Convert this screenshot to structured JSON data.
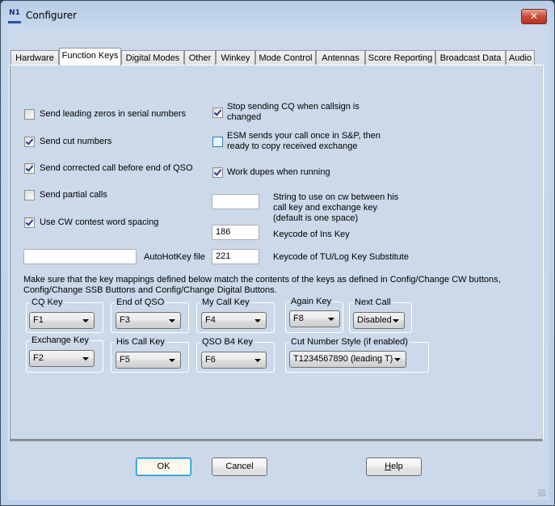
{
  "window": {
    "title": "Configurer",
    "app_icon": "N1MM-logo-icon",
    "close_label": "x"
  },
  "tabs": [
    {
      "label": "Hardware",
      "active": false
    },
    {
      "label": "Function Keys",
      "active": true
    },
    {
      "label": "Digital Modes",
      "active": false
    },
    {
      "label": "Other",
      "active": false
    },
    {
      "label": "Winkey",
      "active": false
    },
    {
      "label": "Mode Control",
      "active": false
    },
    {
      "label": "Antennas",
      "active": false
    },
    {
      "label": "Score Reporting",
      "active": false
    },
    {
      "label": "Broadcast Data",
      "active": false
    },
    {
      "label": "Audio",
      "active": false
    }
  ],
  "left_checkboxes": [
    {
      "label": "Send leading zeros in serial numbers",
      "checked": false
    },
    {
      "label": "Send cut numbers",
      "checked": true
    },
    {
      "label": "Send corrected call before end of QSO",
      "checked": true
    },
    {
      "label": "Send partial calls",
      "checked": false
    },
    {
      "label": "Use CW contest word spacing",
      "checked": true
    }
  ],
  "right_checkboxes": [
    {
      "label_line1": "Stop sending CQ when callsign is",
      "label_line2": "changed",
      "checked": true
    },
    {
      "label_line1": "ESM sends your call once in S&P, then",
      "label_line2": "ready to copy received exchange",
      "checked": false
    },
    {
      "label_line1": "Work dupes when running",
      "label_line2": "",
      "checked": true
    }
  ],
  "fields": {
    "cw_string": {
      "value": "",
      "label_line1": "String to use on cw between his",
      "label_line2": "call key and exchange key",
      "label_line3": "(default is one space)"
    },
    "ins_keycode": {
      "value": "186",
      "label": "Keycode of Ins Key"
    },
    "tu_keycode": {
      "value": "221",
      "label": "Keycode of TU/Log Key Substitute"
    },
    "autohotkey": {
      "value": "",
      "label": "AutoHotKey file"
    }
  },
  "note": {
    "line1": "Make sure that the key mappings defined below match the contents of the keys as defined in Config/Change CW buttons,",
    "line2": "Config/Change SSB Buttons and Config/Change Digital Buttons."
  },
  "key_groups": [
    {
      "label": "CQ Key",
      "value": "F1"
    },
    {
      "label": "End of QSO",
      "value": "F3"
    },
    {
      "label": "My Call Key",
      "value": "F4"
    },
    {
      "label": "Again  Key",
      "value": "F8"
    },
    {
      "label": "Next Call",
      "value": "Disabled"
    },
    {
      "label": "Exchange  Key",
      "value": "F2"
    },
    {
      "label": "His Call Key",
      "value": "F5"
    },
    {
      "label": "QSO B4 Key",
      "value": "F6"
    },
    {
      "label": "Cut Number Style (if enabled)",
      "value": "T1234567890 (leading T)"
    }
  ],
  "buttons": {
    "ok": "OK",
    "cancel": "Cancel",
    "help_prefix": "H",
    "help_rest": "elp"
  },
  "colors": {
    "panel_bg": "#cbd9ea",
    "close_red": "#cc4a36",
    "default_button_border": "#3c7fb1"
  }
}
